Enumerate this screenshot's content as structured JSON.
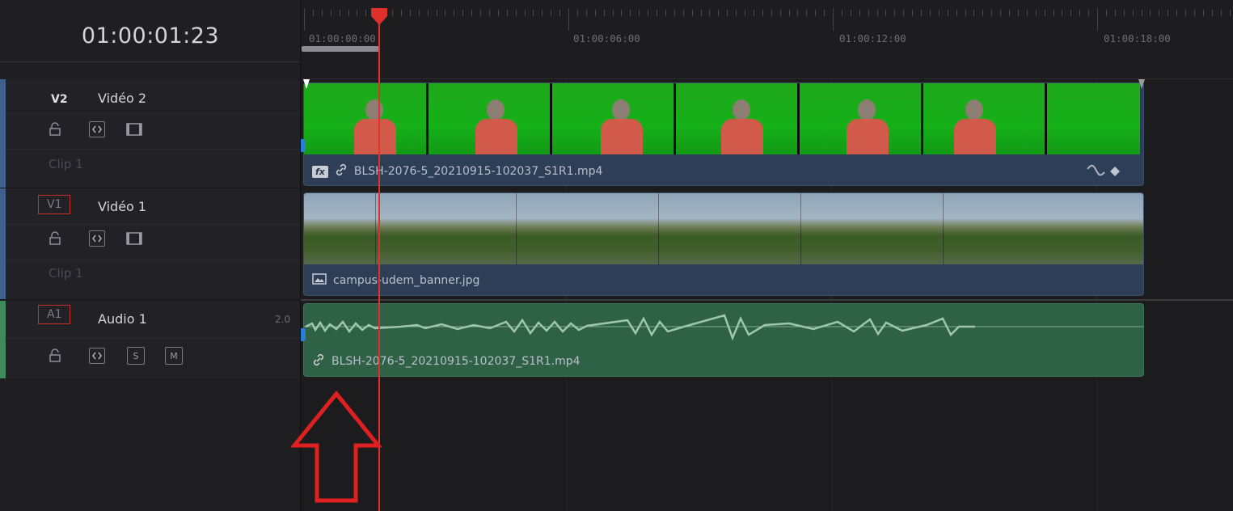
{
  "header": {
    "timecode": "01:00:01:23"
  },
  "ruler": {
    "labels": [
      "01:00:00:00",
      "01:00:06:00",
      "01:00:12:00",
      "01:00:18:00"
    ]
  },
  "tracks": {
    "v2": {
      "id": "V2",
      "name": "Vidéo 2",
      "clip_label": "Clip 1"
    },
    "v1": {
      "id": "V1",
      "name": "Vidéo 1",
      "clip_label": "Clip 1"
    },
    "a1": {
      "id": "A1",
      "name": "Audio 1",
      "level": "2.0",
      "solo": "S",
      "mute": "M"
    }
  },
  "clips": {
    "v2_clip": {
      "fx": "fx",
      "filename": "BLSH-2076-5_20210915-102037_S1R1.mp4"
    },
    "v1_clip": {
      "filename": "campus-udem_banner.jpg"
    },
    "a1_clip": {
      "filename": "BLSH-2076-5_20210915-102037_S1R1.mp4"
    }
  },
  "colors": {
    "playhead": "#e0302b",
    "video_track_edge": "#4a6a9a",
    "audio_track_edge": "#3f8a5a",
    "annotation": "#e02020"
  }
}
